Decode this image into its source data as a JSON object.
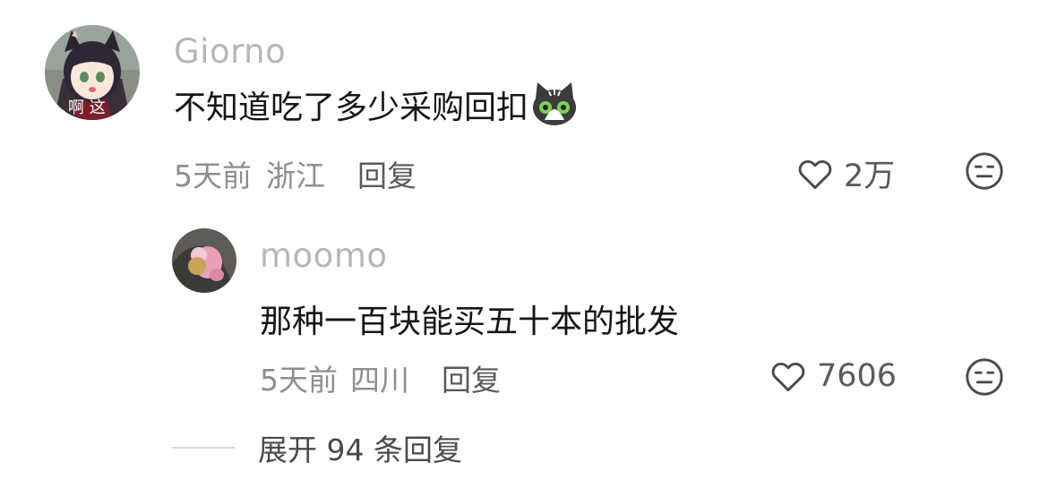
{
  "comments": [
    {
      "username": "Giorno",
      "avatar_caption": "啊 这",
      "text": "不知道吃了多少采购回扣",
      "emoji": "cat-face-emoji",
      "time": "5天前",
      "location": "浙江",
      "reply_label": "回复",
      "likes": "2万"
    },
    {
      "username": "moomo",
      "text": "那种一百块能买五十本的批发",
      "time": "5天前",
      "location": "四川",
      "reply_label": "回复",
      "likes": "7606"
    }
  ],
  "expand_label": "展开 94 条回复",
  "icons": {
    "like": "heart-outline-icon",
    "dislike": "meh-face-icon"
  },
  "colors": {
    "username": "#b6b6b6",
    "text": "#161616",
    "meta": "#8e8e8e",
    "action": "#5a5a5a"
  }
}
